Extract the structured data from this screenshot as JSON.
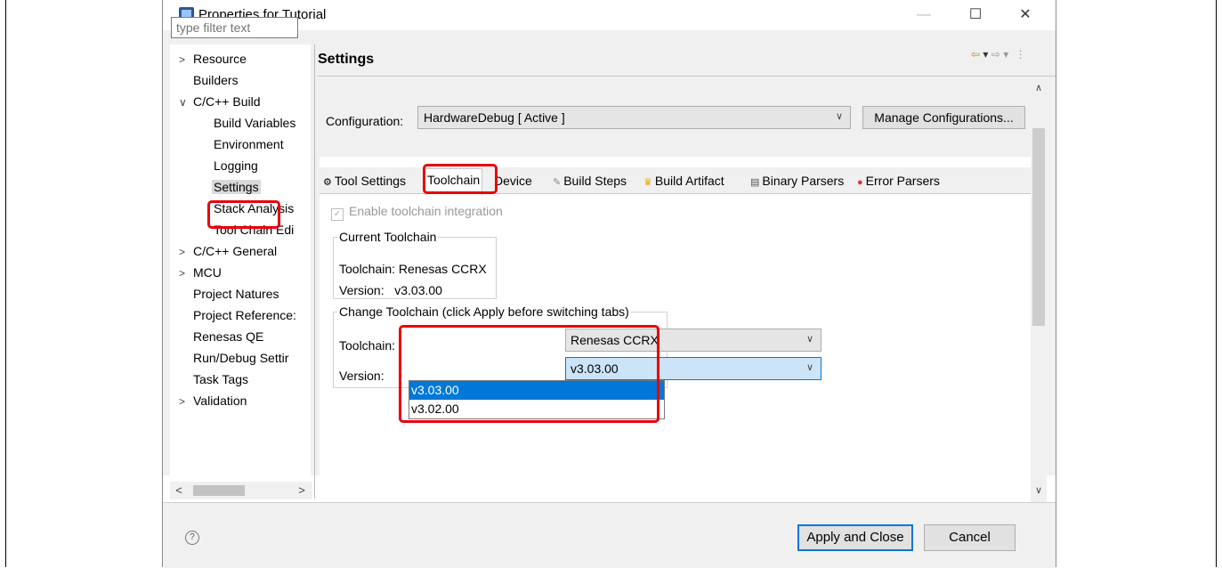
{
  "window": {
    "title": "Properties for Tutorial",
    "controls": {
      "minimize": "—",
      "maximize": "☐",
      "close": "✕"
    }
  },
  "filter": {
    "placeholder": "type filter text"
  },
  "tree": {
    "items": [
      {
        "label": "Resource",
        "twisty": ">"
      },
      {
        "label": "Builders"
      },
      {
        "label": "C/C++ Build",
        "twisty": "∨"
      },
      {
        "label": "Build Variables"
      },
      {
        "label": "Environment"
      },
      {
        "label": "Logging"
      },
      {
        "label": "Settings"
      },
      {
        "label": "Stack Analysis"
      },
      {
        "label": "Tool Chain Edi"
      },
      {
        "label": "C/C++ General",
        "twisty": ">"
      },
      {
        "label": "MCU",
        "twisty": ">"
      },
      {
        "label": "Project Natures"
      },
      {
        "label": "Project Reference:"
      },
      {
        "label": "Renesas QE"
      },
      {
        "label": "Run/Debug Settir"
      },
      {
        "label": "Task Tags"
      },
      {
        "label": "Validation",
        "twisty": ">"
      }
    ],
    "scroll_left": "<",
    "scroll_right": ">"
  },
  "page": {
    "title": "Settings"
  },
  "configuration": {
    "label": "Configuration:",
    "value": "HardwareDebug  [ Active ]",
    "manage_button": "Manage Configurations..."
  },
  "tabs": [
    {
      "label": "Tool Settings",
      "icon": "tool-settings-icon"
    },
    {
      "label": "Toolchain",
      "active": true
    },
    {
      "label": "Device"
    },
    {
      "label": "Build Steps",
      "icon": "build-steps-icon"
    },
    {
      "label": "Build Artifact",
      "icon": "trophy-icon"
    },
    {
      "label": "Binary Parsers",
      "icon": "binary-icon"
    },
    {
      "label": "Error Parsers",
      "icon": "error-icon"
    }
  ],
  "toolchain": {
    "enable_label": "Enable toolchain integration",
    "current": {
      "group_label": "Current Toolchain",
      "toolchain_line": "Toolchain: Renesas CCRX",
      "version_line": "Version:   v3.03.00"
    },
    "change": {
      "group_label": "Change Toolchain (click Apply before switching tabs)",
      "toolchain_label": "Toolchain:",
      "toolchain_value": "Renesas CCRX",
      "version_label": "Version:",
      "version_value": "v3.03.00",
      "version_options": [
        "v3.03.00",
        "v3.02.00"
      ]
    }
  },
  "footer": {
    "help": "?",
    "apply_close": "Apply and Close",
    "cancel": "Cancel"
  },
  "colors": {
    "highlight": "#e8000d",
    "selection": "#0078d7"
  }
}
